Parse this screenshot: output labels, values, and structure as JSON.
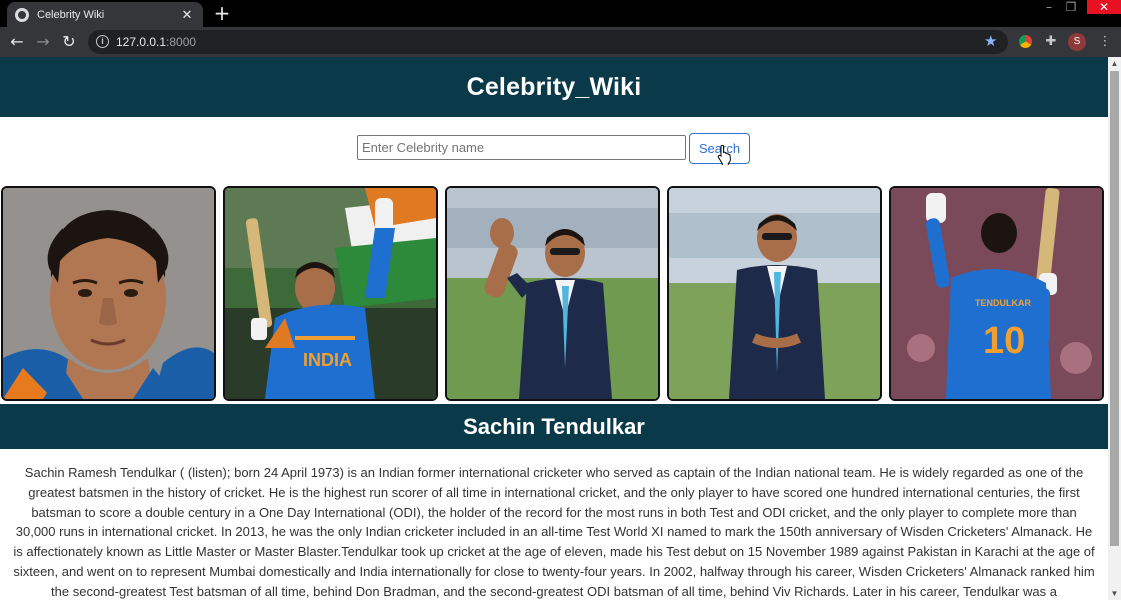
{
  "browser": {
    "tab_title": "Celebrity Wiki",
    "tab_close": "✕",
    "new_tab": "+",
    "url_host": "127.0.0.1",
    "url_port": ":8000",
    "profile_initial": "S"
  },
  "site": {
    "title": "Celebrity_Wiki"
  },
  "search": {
    "placeholder": "Enter Celebrity name",
    "value": "",
    "button_label": "Search"
  },
  "gallery": {
    "photos": [
      {
        "subject": "portrait-headshot"
      },
      {
        "subject": "celebrating-with-bat"
      },
      {
        "subject": "waving-in-suit"
      },
      {
        "subject": "standing-in-suit"
      },
      {
        "subject": "raising-bat-jersey-10"
      }
    ],
    "jersey_text": "TENDULKAR",
    "jersey_number": "10",
    "shirt_text": "INDIA"
  },
  "celebrity": {
    "name": "Sachin Tendulkar",
    "bio": "Sachin Ramesh Tendulkar ( (listen); born 24 April 1973) is an Indian former international cricketer who served as captain of the Indian national team. He is widely regarded as one of the greatest batsmen in the history of cricket. He is the highest run scorer of all time in international cricket, and the only player to have scored one hundred international centuries, the first batsman to score a double century in a One Day International (ODI), the holder of the record for the most runs in both Test and ODI cricket, and the only player to complete more than 30,000 runs in international cricket. In 2013, he was the only Indian cricketer included in an all-time Test World XI named to mark the 150th anniversary of Wisden Cricketers' Almanack. He is affectionately known as Little Master or Master Blaster.Tendulkar took up cricket at the age of eleven, made his Test debut on 15 November 1989 against Pakistan in Karachi at the age of sixteen, and went on to represent Mumbai domestically and India internationally for close to twenty-four years. In 2002, halfway through his career, Wisden Cricketers' Almanack ranked him the second-greatest Test batsman of all time, behind Don Bradman, and the second-greatest ODI batsman of all time, behind Viv Richards. Later in his career, Tendulkar was a"
  },
  "colors": {
    "header_bg": "#0a3a4a",
    "button_accent": "#2f6fd6",
    "jersey_blue": "#1e6fd0"
  },
  "icons": {
    "back": "back-arrow-icon",
    "forward": "forward-arrow-icon",
    "reload": "reload-icon",
    "info": "info-icon",
    "bookmark": "star-icon",
    "extensions": "puzzle-icon",
    "menu": "kebab-menu-icon",
    "cursor": "hand-cursor-icon"
  }
}
